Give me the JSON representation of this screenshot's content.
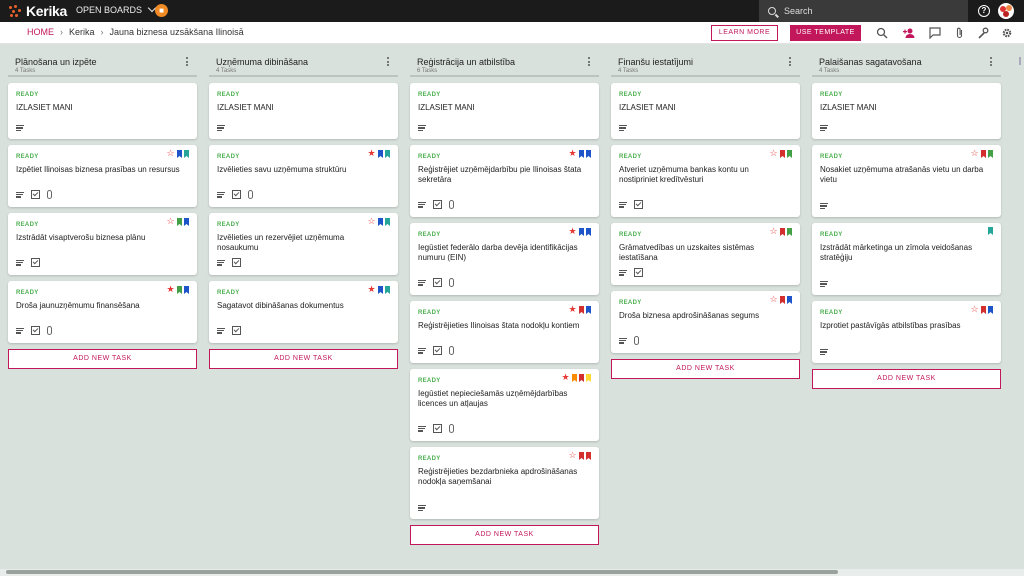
{
  "topbar": {
    "logo_text": "Kerika",
    "open_boards_label": "OPEN BOARDS",
    "org_icon": "building-icon",
    "search_placeholder": "Search",
    "help_icon": "help-icon",
    "avatar_icon": "avatar"
  },
  "header": {
    "breadcrumb": [
      "HOME",
      "Kerika",
      "Jauna biznesa uzsākšana Ilinoisā"
    ],
    "learn_more_label": "LEARN MORE",
    "use_template_label": "USE TEMPLATE",
    "icons": [
      "search-icon",
      "add-person-icon",
      "chat-icon",
      "attachment-icon",
      "wrench-icon",
      "gear-icon"
    ]
  },
  "colors": {
    "brand": "#c2185b",
    "ready": "#4caf50",
    "star_red": "#e53935",
    "flag_blue": "#1e56c9",
    "flag_green": "#43a047",
    "flag_teal": "#26a69a",
    "flag_red": "#d32f2f",
    "flag_orange": "#fb8c00",
    "flag_yellow": "#fdd835"
  },
  "add_task_label": "ADD NEW TASK",
  "columns": [
    {
      "title": "Plānošana un izpēte",
      "count": "4 Tasks",
      "cards": [
        {
          "status": "READY",
          "title": "IZLASIET MANI",
          "star": "",
          "tags": [],
          "desc": true,
          "checklist": false,
          "attach": false,
          "height": 56
        },
        {
          "status": "READY",
          "title": "Izpētiet Ilinoisas biznesa prasības un resursus",
          "star": "outline",
          "tags": [
            "#1e56c9",
            "#26a69a"
          ],
          "desc": true,
          "checklist": true,
          "attach": true,
          "height": 62
        },
        {
          "status": "READY",
          "title": "Izstrādāt visaptverošu biznesa plānu",
          "star": "outline",
          "tags": [
            "#43a047",
            "#1e56c9"
          ],
          "desc": true,
          "checklist": true,
          "attach": false,
          "height": 62
        },
        {
          "status": "READY",
          "title": "Droša jaunuzņēmumu finansēšana",
          "star": "filled",
          "tags": [
            "#43a047",
            "#1e56c9"
          ],
          "desc": true,
          "checklist": true,
          "attach": true,
          "height": 62
        }
      ]
    },
    {
      "title": "Uzņēmuma dibināšana",
      "count": "4 Tasks",
      "cards": [
        {
          "status": "READY",
          "title": "IZLASIET MANI",
          "star": "",
          "tags": [],
          "desc": true,
          "checklist": false,
          "attach": false,
          "height": 56
        },
        {
          "status": "READY",
          "title": "Izvēlieties savu uzņēmuma struktūru",
          "star": "filled",
          "tags": [
            "#1e56c9",
            "#26a69a"
          ],
          "desc": true,
          "checklist": true,
          "attach": true,
          "height": 62
        },
        {
          "status": "READY",
          "title": "Izvēlieties un rezervējiet uzņēmuma nosaukumu",
          "star": "outline",
          "tags": [
            "#1e56c9",
            "#26a69a"
          ],
          "desc": true,
          "checklist": true,
          "attach": false,
          "height": 62
        },
        {
          "status": "READY",
          "title": "Sagatavot dibināšanas dokumentus",
          "star": "filled",
          "tags": [
            "#1e56c9",
            "#26a69a"
          ],
          "desc": true,
          "checklist": true,
          "attach": false,
          "height": 62
        }
      ]
    },
    {
      "title": "Reģistrācija un atbilstība",
      "count": "6 Tasks",
      "cards": [
        {
          "status": "READY",
          "title": "IZLASIET MANI",
          "star": "",
          "tags": [],
          "desc": true,
          "checklist": false,
          "attach": false,
          "height": 56
        },
        {
          "status": "READY",
          "title": "Reģistrējiet uzņēmējdarbību pie Ilinoisas štata sekretāra",
          "star": "filled",
          "tags": [
            "#1e56c9",
            "#1e56c9"
          ],
          "desc": true,
          "checklist": true,
          "attach": true,
          "height": 72
        },
        {
          "status": "READY",
          "title": "Iegūstiet federālo darba devēja identifikācijas numuru (EIN)",
          "star": "filled",
          "tags": [
            "#1e56c9",
            "#1e56c9"
          ],
          "desc": true,
          "checklist": true,
          "attach": true,
          "height": 72
        },
        {
          "status": "READY",
          "title": "Reģistrējieties Ilinoisas štata nodokļu kontiem",
          "star": "filled",
          "tags": [
            "#d32f2f",
            "#1e56c9"
          ],
          "desc": true,
          "checklist": true,
          "attach": true,
          "height": 62
        },
        {
          "status": "READY",
          "title": "Iegūstiet nepieciešamās uzņēmējdarbības licences un atļaujas",
          "star": "filled",
          "tags": [
            "#fb8c00",
            "#d32f2f",
            "#fdd835"
          ],
          "desc": true,
          "checklist": true,
          "attach": true,
          "height": 72
        },
        {
          "status": "READY",
          "title": "Reģistrējieties bezdarbnieka apdrošināšanas nodokļa saņemšanai",
          "star": "outline",
          "tags": [
            "#d32f2f",
            "#d32f2f"
          ],
          "desc": true,
          "checklist": false,
          "attach": false,
          "height": 72
        }
      ]
    },
    {
      "title": "Finanšu iestatījumi",
      "count": "4 Tasks",
      "cards": [
        {
          "status": "READY",
          "title": "IZLASIET MANI",
          "star": "",
          "tags": [],
          "desc": true,
          "checklist": false,
          "attach": false,
          "height": 56
        },
        {
          "status": "READY",
          "title": "Atveriet uzņēmuma bankas kontu un nostipriniet kredītvēsturi",
          "star": "outline",
          "tags": [
            "#d32f2f",
            "#43a047"
          ],
          "desc": true,
          "checklist": true,
          "attach": false,
          "height": 72
        },
        {
          "status": "READY",
          "title": "Grāmatvedības un uzskaites sistēmas iestatīšana",
          "star": "outline",
          "tags": [
            "#d32f2f",
            "#43a047"
          ],
          "desc": true,
          "checklist": true,
          "attach": false,
          "height": 62
        },
        {
          "status": "READY",
          "title": "Droša biznesa apdrošināšanas segums",
          "star": "outline",
          "tags": [
            "#d32f2f",
            "#1e56c9"
          ],
          "desc": true,
          "checklist": false,
          "attach": true,
          "height": 62
        }
      ]
    },
    {
      "title": "Palaišanas sagatavošana",
      "count": "4 Tasks",
      "cards": [
        {
          "status": "READY",
          "title": "IZLASIET MANI",
          "star": "",
          "tags": [],
          "desc": true,
          "checklist": false,
          "attach": false,
          "height": 56
        },
        {
          "status": "READY",
          "title": "Nosakiet uzņēmuma atrašanās vietu un darba vietu",
          "star": "outline",
          "tags": [
            "#d32f2f",
            "#43a047"
          ],
          "desc": true,
          "checklist": false,
          "attach": false,
          "height": 72
        },
        {
          "status": "READY",
          "title": "Izstrādāt mārketinga un zīmola veidošanas stratēģiju",
          "star": "",
          "tags": [
            "#26a69a"
          ],
          "desc": true,
          "checklist": false,
          "attach": false,
          "height": 72
        },
        {
          "status": "READY",
          "title": "Izprotiet pastāvīgās atbilstības prasības",
          "star": "outline",
          "tags": [
            "#d32f2f",
            "#1e56c9"
          ],
          "desc": true,
          "checklist": false,
          "attach": false,
          "height": 62
        }
      ]
    }
  ]
}
